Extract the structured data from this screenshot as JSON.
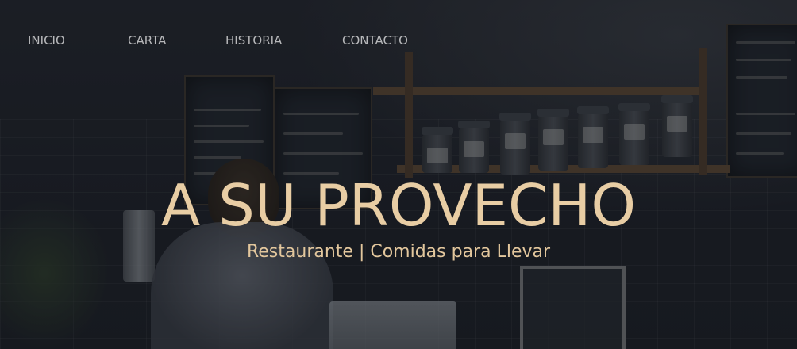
{
  "nav": {
    "items": [
      "INICIO",
      "CARTA",
      "HISTORIA",
      "CONTACTO"
    ]
  },
  "hero": {
    "title": "A SU PROVECHO",
    "subtitle": "Restaurante | Comidas para Llevar"
  },
  "colors": {
    "title": "#e8cda4",
    "subtitle": "#e3c79d",
    "nav": "#b8b9bb"
  }
}
